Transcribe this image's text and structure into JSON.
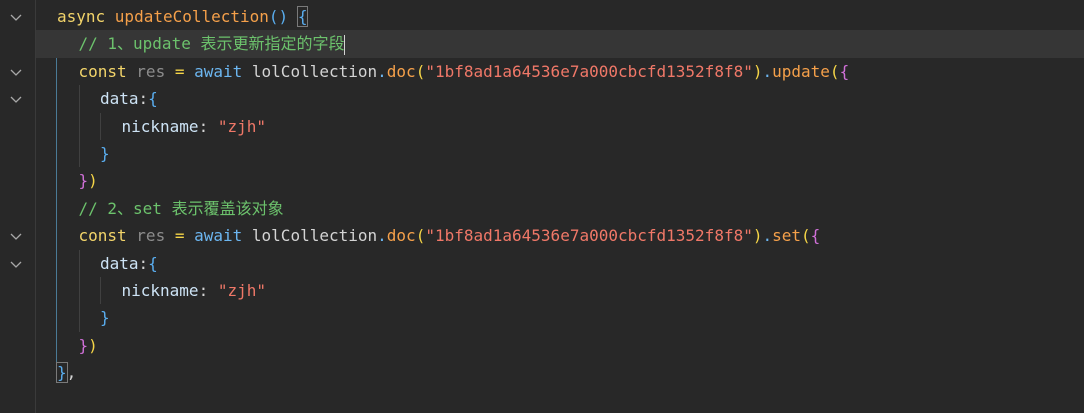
{
  "fold_lines": [
    0,
    2,
    3,
    8,
    9
  ],
  "current_line": 1,
  "lines": [
    {
      "indent": 0,
      "tokens": [
        {
          "t": "async ",
          "c": "kw"
        },
        {
          "t": "updateCollection",
          "c": "fn"
        },
        {
          "t": "()",
          "c": "p2"
        },
        {
          "t": " ",
          "c": "op"
        },
        {
          "t": "{",
          "c": "p2 bracketbox"
        }
      ]
    },
    {
      "indent": 1,
      "tokens": [
        {
          "t": "// 1、update 表示更新指定的字段",
          "c": "cm"
        }
      ],
      "cursor": true
    },
    {
      "indent": 1,
      "tokens": [
        {
          "t": "const ",
          "c": "kw"
        },
        {
          "t": "res",
          "c": "var"
        },
        {
          "t": " = ",
          "c": "p1"
        },
        {
          "t": "await ",
          "c": "aw"
        },
        {
          "t": "lolCollection",
          "c": "id"
        },
        {
          "t": ".",
          "c": "aw"
        },
        {
          "t": "doc",
          "c": "fn"
        },
        {
          "t": "(",
          "c": "p1"
        },
        {
          "t": "\"1bf8ad1a64536e7a000cbcfd1352f8f8\"",
          "c": "str"
        },
        {
          "t": ")",
          "c": "p1"
        },
        {
          "t": ".",
          "c": "aw"
        },
        {
          "t": "update",
          "c": "fn"
        },
        {
          "t": "(",
          "c": "p1"
        },
        {
          "t": "{",
          "c": "p3"
        }
      ]
    },
    {
      "indent": 2,
      "tokens": [
        {
          "t": "data",
          "c": "key"
        },
        {
          "t": ":",
          "c": "op"
        },
        {
          "t": "{",
          "c": "p2"
        }
      ]
    },
    {
      "indent": 3,
      "tokens": [
        {
          "t": "nickname",
          "c": "key"
        },
        {
          "t": ": ",
          "c": "op"
        },
        {
          "t": "\"zjh\"",
          "c": "str"
        }
      ]
    },
    {
      "indent": 2,
      "tokens": [
        {
          "t": "}",
          "c": "p2"
        }
      ]
    },
    {
      "indent": 1,
      "tokens": [
        {
          "t": "}",
          "c": "p3"
        },
        {
          "t": ")",
          "c": "p1"
        }
      ]
    },
    {
      "indent": 1,
      "tokens": [
        {
          "t": "// 2、set 表示覆盖该对象",
          "c": "cm"
        }
      ]
    },
    {
      "indent": 1,
      "tokens": [
        {
          "t": "const ",
          "c": "kw"
        },
        {
          "t": "res",
          "c": "var"
        },
        {
          "t": " = ",
          "c": "p1"
        },
        {
          "t": "await ",
          "c": "aw"
        },
        {
          "t": "lolCollection",
          "c": "id"
        },
        {
          "t": ".",
          "c": "aw"
        },
        {
          "t": "doc",
          "c": "fn"
        },
        {
          "t": "(",
          "c": "p1"
        },
        {
          "t": "\"1bf8ad1a64536e7a000cbcfd1352f8f8\"",
          "c": "str"
        },
        {
          "t": ")",
          "c": "p1"
        },
        {
          "t": ".",
          "c": "aw"
        },
        {
          "t": "set",
          "c": "fn"
        },
        {
          "t": "(",
          "c": "p1"
        },
        {
          "t": "{",
          "c": "p3"
        }
      ]
    },
    {
      "indent": 2,
      "tokens": [
        {
          "t": "data",
          "c": "key"
        },
        {
          "t": ":",
          "c": "op"
        },
        {
          "t": "{",
          "c": "p2"
        }
      ]
    },
    {
      "indent": 3,
      "tokens": [
        {
          "t": "nickname",
          "c": "key"
        },
        {
          "t": ": ",
          "c": "op"
        },
        {
          "t": "\"zjh\"",
          "c": "str"
        }
      ]
    },
    {
      "indent": 2,
      "tokens": [
        {
          "t": "}",
          "c": "p2"
        }
      ]
    },
    {
      "indent": 1,
      "tokens": [
        {
          "t": "}",
          "c": "p3"
        },
        {
          "t": ")",
          "c": "p1"
        }
      ]
    },
    {
      "indent": 0,
      "tokens": [
        {
          "t": "}",
          "c": "p2 bracketbox"
        },
        {
          "t": ",",
          "c": "op"
        }
      ]
    }
  ]
}
